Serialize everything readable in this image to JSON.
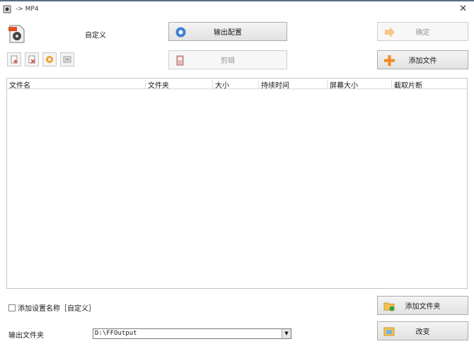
{
  "window": {
    "title": "-> MP4"
  },
  "preset": {
    "label": "自定义"
  },
  "toolbar": {
    "output_config": "输出配置",
    "confirm": "确定",
    "clip": "剪辑",
    "add_file": "添加文件"
  },
  "small_tools": [
    {
      "icon": "add-page-icon"
    },
    {
      "icon": "delete-page-icon"
    },
    {
      "icon": "play-circle-icon"
    },
    {
      "icon": "info-card-icon"
    }
  ],
  "table": {
    "columns": [
      "文件名",
      "文件夹",
      "大小",
      "持续时间",
      "屏幕大小",
      "截取片断"
    ],
    "rows": []
  },
  "options": {
    "add_setting_name": "添加设置名称［自定义］"
  },
  "output": {
    "folder_label": "输出文件夹",
    "folder_value": "D:\\FFOutput",
    "add_folder": "添加文件夹",
    "change": "改变"
  },
  "colors": {
    "accent_orange": "#f0a030",
    "title_border": "#5a6f86"
  }
}
